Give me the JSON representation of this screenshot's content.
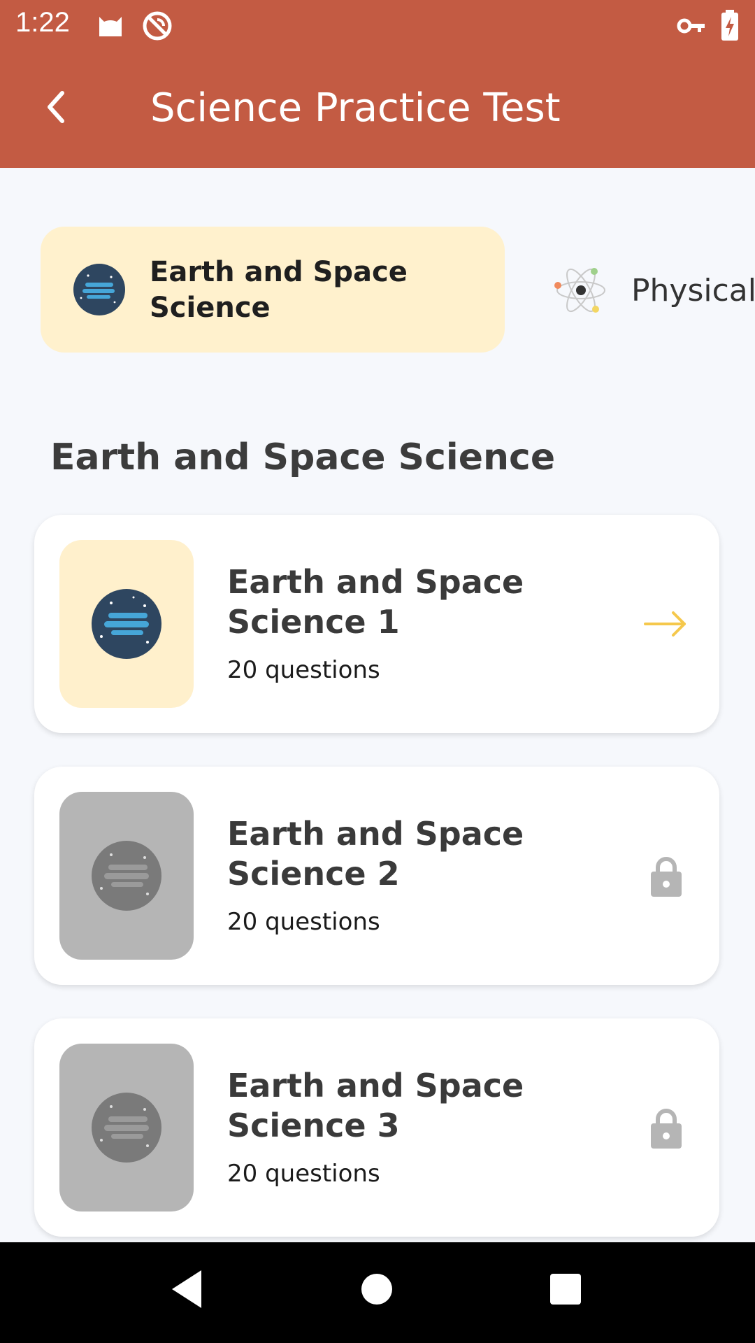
{
  "status": {
    "time": "1:22"
  },
  "appbar": {
    "title": "Science Practice Test"
  },
  "categories": [
    {
      "label": "Earth and Space Science",
      "selected": true,
      "icon": "planet-icon"
    },
    {
      "label": "Physical",
      "selected": false,
      "icon": "atom-icon"
    }
  ],
  "section": {
    "title": "Earth and Space Science"
  },
  "tests": [
    {
      "title": "Earth and Space Science 1",
      "count": "20 questions",
      "locked": false,
      "action_icon": "arrow-right-icon"
    },
    {
      "title": "Earth and Space Science 2",
      "count": "20 questions",
      "locked": true,
      "action_icon": "lock-icon"
    },
    {
      "title": "Earth and Space Science 3",
      "count": "20 questions",
      "locked": true,
      "action_icon": "lock-icon"
    }
  ],
  "colors": {
    "primary": "#c35b43",
    "accent": "#f5c84c",
    "chip_bg": "#fff1cd",
    "locked": "#b5b5b5"
  }
}
